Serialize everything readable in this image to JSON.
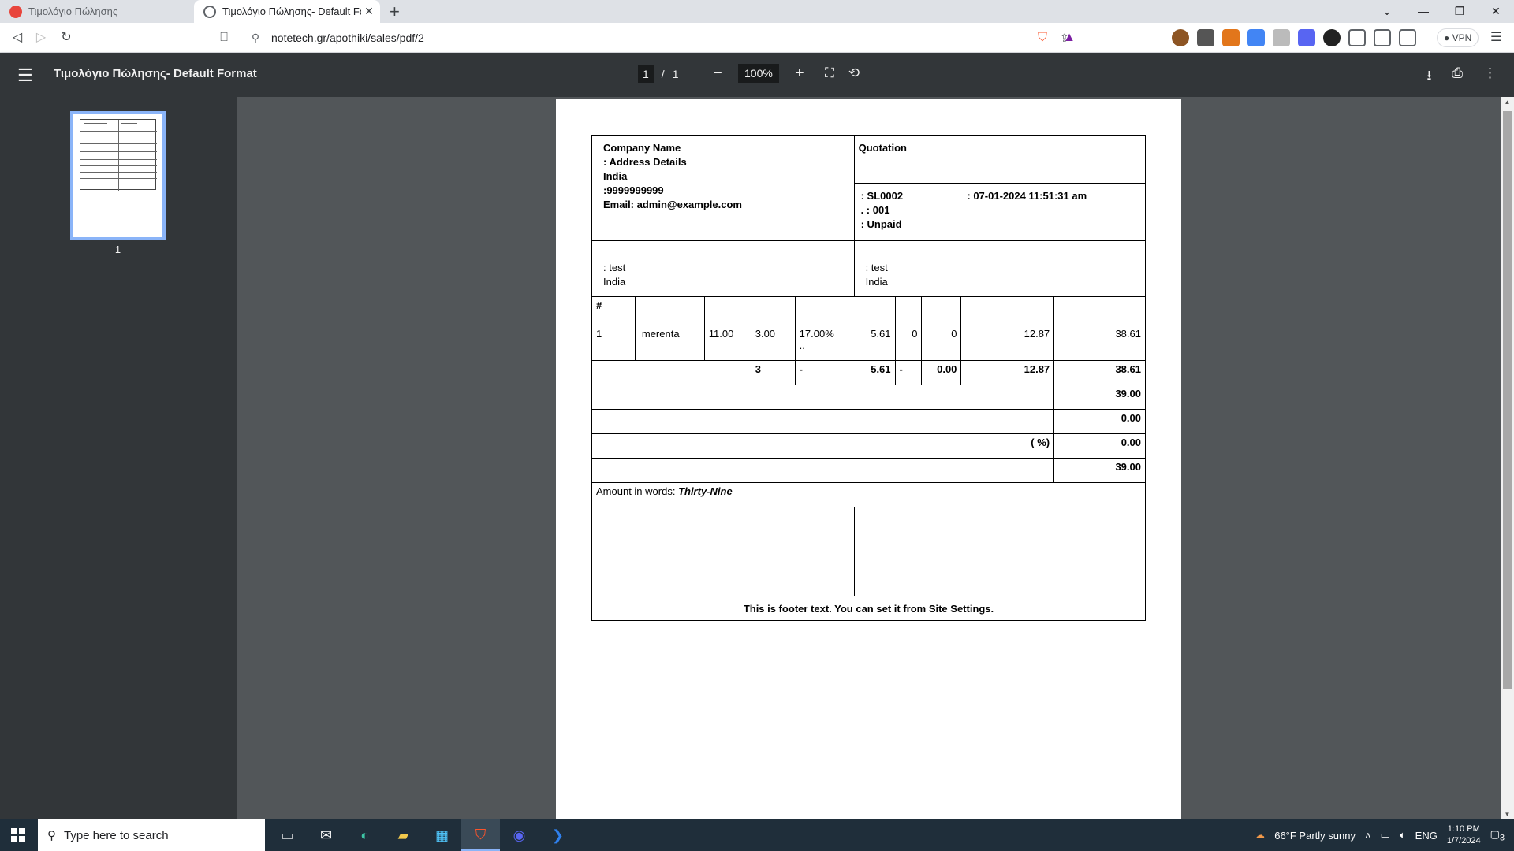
{
  "browser": {
    "tabs": [
      {
        "title": "Τιμολόγιο Πώλησης",
        "active": false
      },
      {
        "title": "Τιμολόγιο Πώλησης- Default For",
        "active": true
      }
    ],
    "url": "notetech.gr/apothiki/sales/pdf/2",
    "vpn_label": "VPN"
  },
  "pdf": {
    "title": "Τιμολόγιο Πώλησης- Default Format",
    "current_page": "1",
    "page_separator": "/",
    "total_pages": "1",
    "zoom": "100%",
    "thumb_label": "1"
  },
  "invoice": {
    "company": {
      "name": "Company Name",
      "address": ": Address Details",
      "country": "India",
      "phone": ":9999999999",
      "email": "Email: admin@example.com"
    },
    "doc_type": "Quotation",
    "meta": {
      "number": ": SL0002",
      "ref": ". : 001",
      "status": ": Unpaid",
      "date": ": 07-01-2024 11:51:31 am"
    },
    "bill_to": {
      "name": ": test",
      "country": "India"
    },
    "ship_to": {
      "name": ": test",
      "country": "India"
    },
    "header_hash": "#",
    "item": {
      "no": "1",
      "name": "merenta",
      "price": "11.00",
      "qty": "3.00",
      "tax_rate": "17.00%",
      "tax_note": "..",
      "tax_amount": "5.61",
      "disc1": "0",
      "disc2": "0",
      "tax_total": "12.87",
      "total": "38.61"
    },
    "totals_row": {
      "qty": "3",
      "dash1": "-",
      "tax": "5.61",
      "dash2": "-",
      "disc": "0.00",
      "tax_total": "12.87",
      "total": "38.61"
    },
    "summary": {
      "subtotal": "39.00",
      "discount": "0.00",
      "tax_label": "( %)",
      "tax": "0.00",
      "grand_total": "39.00"
    },
    "amount_words_label": "Amount in words:",
    "amount_words": "Thirty-Nine",
    "footer": "This is footer text. You can set it from Site Settings."
  },
  "taskbar": {
    "search_placeholder": "Type here to search",
    "weather": "66°F  Partly sunny",
    "lang": "ENG",
    "time": "1:10 PM",
    "date": "1/7/2024",
    "notifications": "3"
  }
}
